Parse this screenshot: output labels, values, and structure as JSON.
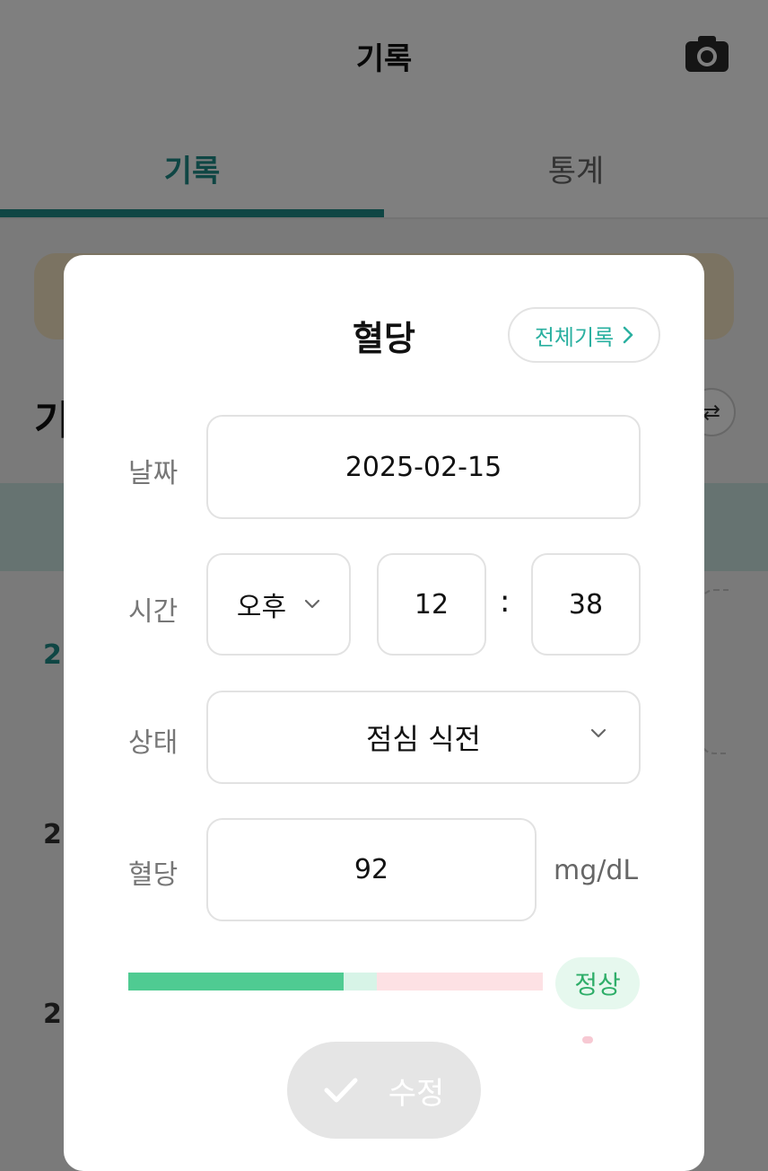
{
  "app": {
    "title": "기록",
    "tabs": [
      {
        "label": "기록",
        "active": true
      },
      {
        "label": "통계",
        "active": false
      }
    ],
    "accent_color": "#1f8c88",
    "background_heading": "기",
    "background_rows": [
      "2",
      "2",
      "2"
    ]
  },
  "modal": {
    "title": "혈당",
    "all_records_label": "전체기록",
    "date": {
      "label": "날짜",
      "value": "2025-02-15"
    },
    "time": {
      "label": "시간",
      "ampm": "오후",
      "hour": "12",
      "separator": ":",
      "minute": "38"
    },
    "state": {
      "label": "상태",
      "value": "점심 식전"
    },
    "glucose": {
      "label": "혈당",
      "value": "92",
      "unit": "mg/dL"
    },
    "range_bar": {
      "level_fraction": 0.52,
      "normal_zone_end_fraction": 0.6
    },
    "status": {
      "label": "정상",
      "color": "#2fae69"
    },
    "submit_label": "수정"
  }
}
